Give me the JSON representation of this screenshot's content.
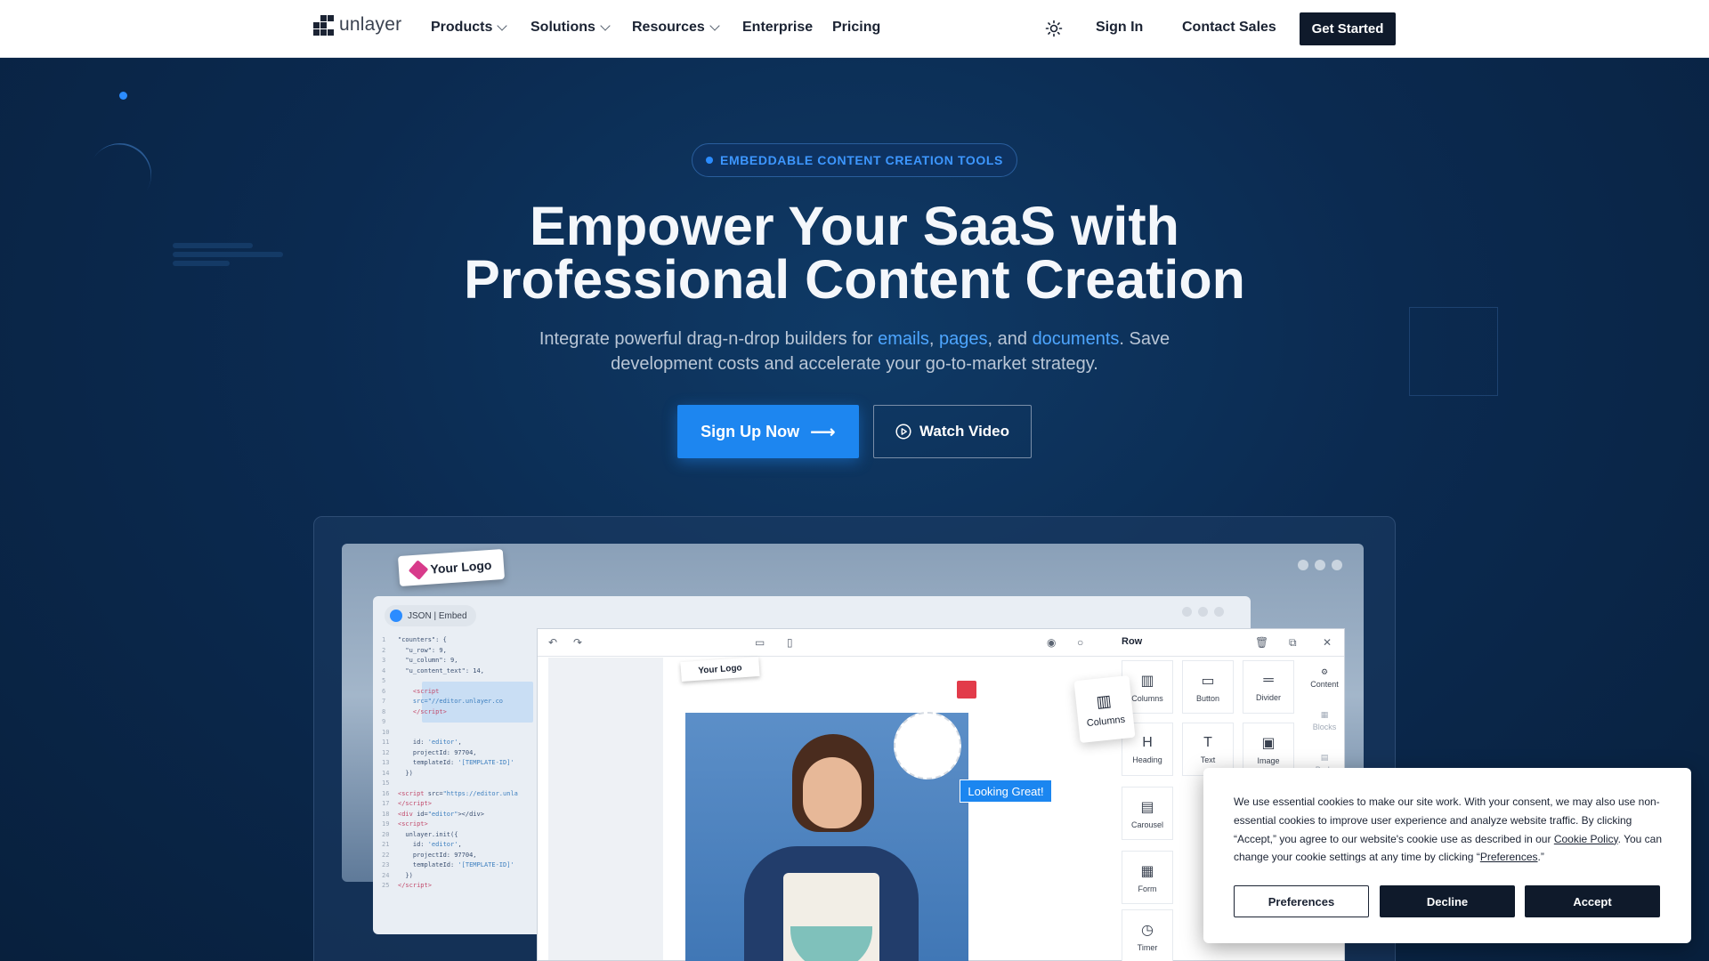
{
  "nav": {
    "logo_text": "unlayer",
    "items": [
      {
        "label": "Products",
        "dropdown": true
      },
      {
        "label": "Solutions",
        "dropdown": true
      },
      {
        "label": "Resources",
        "dropdown": true
      },
      {
        "label": "Enterprise",
        "dropdown": false
      },
      {
        "label": "Pricing",
        "dropdown": false
      }
    ],
    "theme_icon": "sun-icon",
    "sign_in": "Sign In",
    "contact_sales": "Contact Sales",
    "get_started": "Get Started"
  },
  "hero": {
    "badge": "EMBEDDABLE CONTENT CREATION TOOLS",
    "headline_line1": "Empower Your SaaS with",
    "headline_line2": "Professional Content Creation",
    "sub_prefix": "Integrate powerful drag-n-drop builders for ",
    "sub_emails": "emails",
    "sub_comma1": ", ",
    "sub_pages": "pages",
    "sub_and": ", and ",
    "sub_documents": "documents",
    "sub_suffix": ". Save",
    "sub_line2": "development costs and accelerate your go-to-market strategy.",
    "cta_primary": "Sign Up Now",
    "cta_secondary": "Watch Video"
  },
  "showcase": {
    "logo_tag": "Your Logo",
    "json_tag": "JSON | Embed",
    "mini_logo": "Your Logo",
    "toolbar_row_label": "Row",
    "looking_great": "Looking Great!",
    "columns_card": "Columns",
    "tools": [
      {
        "label": "Columns",
        "icon": "columns-icon"
      },
      {
        "label": "Button",
        "icon": "button-icon"
      },
      {
        "label": "Divider",
        "icon": "divider-icon"
      },
      {
        "label": "Heading",
        "icon": "heading-icon"
      },
      {
        "label": "Text",
        "icon": "text-icon"
      },
      {
        "label": "Image",
        "icon": "image-icon"
      },
      {
        "label": "Carousel",
        "icon": "carousel-icon"
      },
      {
        "label": "Form",
        "icon": "form-icon"
      },
      {
        "label": "Timer",
        "icon": "timer-icon"
      }
    ],
    "side_tabs": [
      {
        "label": "Content",
        "icon": "content-icon"
      },
      {
        "label": "Blocks",
        "icon": "blocks-icon"
      },
      {
        "label": "Body",
        "icon": "body-icon"
      }
    ]
  },
  "cookie": {
    "text_1": "We use essential cookies to make our site work. With your consent, we may also use non-essential cookies to improve user experience and analyze website traffic. By clicking “Accept,” you agree to our website's cookie use as described in our ",
    "link_policy": "Cookie Policy",
    "text_2": ". You can change your cookie settings at any time by clicking “",
    "link_pref": "Preferences",
    "text_3": ".”",
    "btn_preferences": "Preferences",
    "btn_decline": "Decline",
    "btn_accept": "Accept"
  },
  "colors": {
    "accent": "#1d86f0",
    "hero_bg": "#0b2748",
    "dark_button": "#0f1a2b"
  }
}
